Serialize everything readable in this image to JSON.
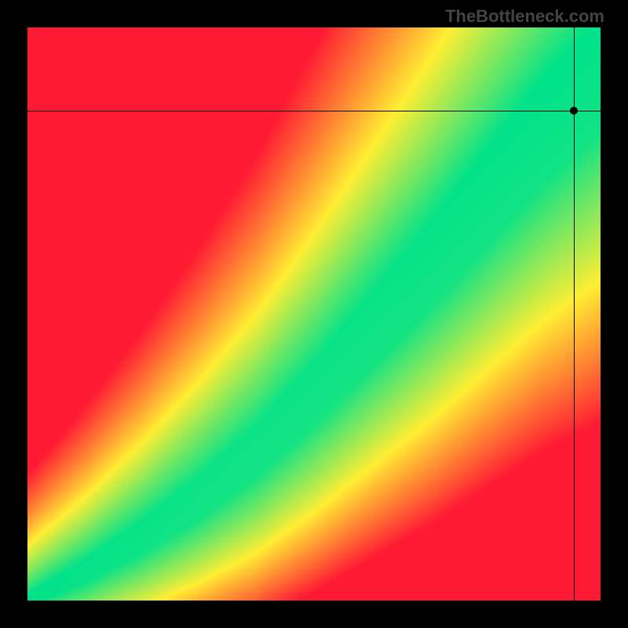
{
  "watermark": "TheBottleneck.com",
  "chart_data": {
    "type": "heatmap",
    "title": "",
    "xlabel": "",
    "ylabel": "",
    "xlim": [
      0,
      1
    ],
    "ylim": [
      0,
      1
    ],
    "colorscale": [
      {
        "stop": 0.0,
        "color": "#ff1a33"
      },
      {
        "stop": 0.5,
        "color": "#ffee33"
      },
      {
        "stop": 1.0,
        "color": "#00e28a"
      }
    ],
    "optimal_band": {
      "description": "Green diagonal band where components are balanced; distance from band encodes bottleneck severity (red = severe, yellow = moderate, green = balanced).",
      "curve_points": [
        {
          "x": 0.0,
          "y": 0.0
        },
        {
          "x": 0.1,
          "y": 0.05
        },
        {
          "x": 0.2,
          "y": 0.11
        },
        {
          "x": 0.3,
          "y": 0.18
        },
        {
          "x": 0.4,
          "y": 0.26
        },
        {
          "x": 0.5,
          "y": 0.36
        },
        {
          "x": 0.6,
          "y": 0.47
        },
        {
          "x": 0.7,
          "y": 0.58
        },
        {
          "x": 0.8,
          "y": 0.7
        },
        {
          "x": 0.9,
          "y": 0.82
        },
        {
          "x": 1.0,
          "y": 0.92
        }
      ],
      "band_halfwidth_start": 0.01,
      "band_halfwidth_end": 0.1
    },
    "marker": {
      "x": 0.955,
      "y": 0.855
    },
    "crosshair": {
      "x": 0.955,
      "y": 0.855
    },
    "grid": false,
    "legend": false
  }
}
